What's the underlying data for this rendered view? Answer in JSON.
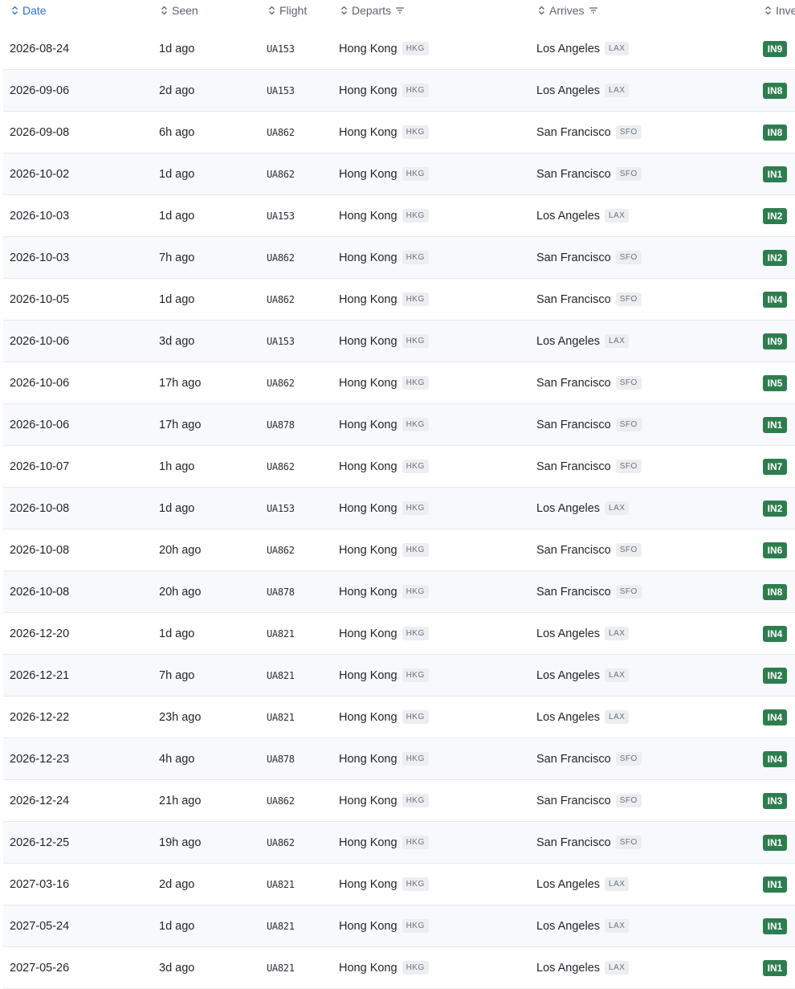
{
  "headers": {
    "date": "Date",
    "seen": "Seen",
    "flight": "Flight",
    "departs": "Departs",
    "arrives": "Arrives",
    "inventory": "Inve"
  },
  "colors": {
    "active_header": "#2f6fd1",
    "inventory_badge": "#2e7d4f"
  },
  "rows": [
    {
      "date": "2026-08-24",
      "seen": "1d ago",
      "flight": "UA153",
      "dep_city": "Hong Kong",
      "dep_code": "HKG",
      "arr_city": "Los Angeles",
      "arr_code": "LAX",
      "inv": "IN9"
    },
    {
      "date": "2026-09-06",
      "seen": "2d ago",
      "flight": "UA153",
      "dep_city": "Hong Kong",
      "dep_code": "HKG",
      "arr_city": "Los Angeles",
      "arr_code": "LAX",
      "inv": "IN8"
    },
    {
      "date": "2026-09-08",
      "seen": "6h ago",
      "flight": "UA862",
      "dep_city": "Hong Kong",
      "dep_code": "HKG",
      "arr_city": "San Francisco",
      "arr_code": "SFO",
      "inv": "IN8"
    },
    {
      "date": "2026-10-02",
      "seen": "1d ago",
      "flight": "UA862",
      "dep_city": "Hong Kong",
      "dep_code": "HKG",
      "arr_city": "San Francisco",
      "arr_code": "SFO",
      "inv": "IN1"
    },
    {
      "date": "2026-10-03",
      "seen": "1d ago",
      "flight": "UA153",
      "dep_city": "Hong Kong",
      "dep_code": "HKG",
      "arr_city": "Los Angeles",
      "arr_code": "LAX",
      "inv": "IN2"
    },
    {
      "date": "2026-10-03",
      "seen": "7h ago",
      "flight": "UA862",
      "dep_city": "Hong Kong",
      "dep_code": "HKG",
      "arr_city": "San Francisco",
      "arr_code": "SFO",
      "inv": "IN2"
    },
    {
      "date": "2026-10-05",
      "seen": "1d ago",
      "flight": "UA862",
      "dep_city": "Hong Kong",
      "dep_code": "HKG",
      "arr_city": "San Francisco",
      "arr_code": "SFO",
      "inv": "IN4"
    },
    {
      "date": "2026-10-06",
      "seen": "3d ago",
      "flight": "UA153",
      "dep_city": "Hong Kong",
      "dep_code": "HKG",
      "arr_city": "Los Angeles",
      "arr_code": "LAX",
      "inv": "IN9"
    },
    {
      "date": "2026-10-06",
      "seen": "17h ago",
      "flight": "UA862",
      "dep_city": "Hong Kong",
      "dep_code": "HKG",
      "arr_city": "San Francisco",
      "arr_code": "SFO",
      "inv": "IN5"
    },
    {
      "date": "2026-10-06",
      "seen": "17h ago",
      "flight": "UA878",
      "dep_city": "Hong Kong",
      "dep_code": "HKG",
      "arr_city": "San Francisco",
      "arr_code": "SFO",
      "inv": "IN1"
    },
    {
      "date": "2026-10-07",
      "seen": "1h ago",
      "flight": "UA862",
      "dep_city": "Hong Kong",
      "dep_code": "HKG",
      "arr_city": "San Francisco",
      "arr_code": "SFO",
      "inv": "IN7"
    },
    {
      "date": "2026-10-08",
      "seen": "1d ago",
      "flight": "UA153",
      "dep_city": "Hong Kong",
      "dep_code": "HKG",
      "arr_city": "Los Angeles",
      "arr_code": "LAX",
      "inv": "IN2"
    },
    {
      "date": "2026-10-08",
      "seen": "20h ago",
      "flight": "UA862",
      "dep_city": "Hong Kong",
      "dep_code": "HKG",
      "arr_city": "San Francisco",
      "arr_code": "SFO",
      "inv": "IN6"
    },
    {
      "date": "2026-10-08",
      "seen": "20h ago",
      "flight": "UA878",
      "dep_city": "Hong Kong",
      "dep_code": "HKG",
      "arr_city": "San Francisco",
      "arr_code": "SFO",
      "inv": "IN8"
    },
    {
      "date": "2026-12-20",
      "seen": "1d ago",
      "flight": "UA821",
      "dep_city": "Hong Kong",
      "dep_code": "HKG",
      "arr_city": "Los Angeles",
      "arr_code": "LAX",
      "inv": "IN4"
    },
    {
      "date": "2026-12-21",
      "seen": "7h ago",
      "flight": "UA821",
      "dep_city": "Hong Kong",
      "dep_code": "HKG",
      "arr_city": "Los Angeles",
      "arr_code": "LAX",
      "inv": "IN2"
    },
    {
      "date": "2026-12-22",
      "seen": "23h ago",
      "flight": "UA821",
      "dep_city": "Hong Kong",
      "dep_code": "HKG",
      "arr_city": "Los Angeles",
      "arr_code": "LAX",
      "inv": "IN4"
    },
    {
      "date": "2026-12-23",
      "seen": "4h ago",
      "flight": "UA878",
      "dep_city": "Hong Kong",
      "dep_code": "HKG",
      "arr_city": "San Francisco",
      "arr_code": "SFO",
      "inv": "IN4"
    },
    {
      "date": "2026-12-24",
      "seen": "21h ago",
      "flight": "UA862",
      "dep_city": "Hong Kong",
      "dep_code": "HKG",
      "arr_city": "San Francisco",
      "arr_code": "SFO",
      "inv": "IN3"
    },
    {
      "date": "2026-12-25",
      "seen": "19h ago",
      "flight": "UA862",
      "dep_city": "Hong Kong",
      "dep_code": "HKG",
      "arr_city": "San Francisco",
      "arr_code": "SFO",
      "inv": "IN1"
    },
    {
      "date": "2027-03-16",
      "seen": "2d ago",
      "flight": "UA821",
      "dep_city": "Hong Kong",
      "dep_code": "HKG",
      "arr_city": "Los Angeles",
      "arr_code": "LAX",
      "inv": "IN1"
    },
    {
      "date": "2027-05-24",
      "seen": "1d ago",
      "flight": "UA821",
      "dep_city": "Hong Kong",
      "dep_code": "HKG",
      "arr_city": "Los Angeles",
      "arr_code": "LAX",
      "inv": "IN1"
    },
    {
      "date": "2027-05-26",
      "seen": "3d ago",
      "flight": "UA821",
      "dep_city": "Hong Kong",
      "dep_code": "HKG",
      "arr_city": "Los Angeles",
      "arr_code": "LAX",
      "inv": "IN1"
    }
  ]
}
